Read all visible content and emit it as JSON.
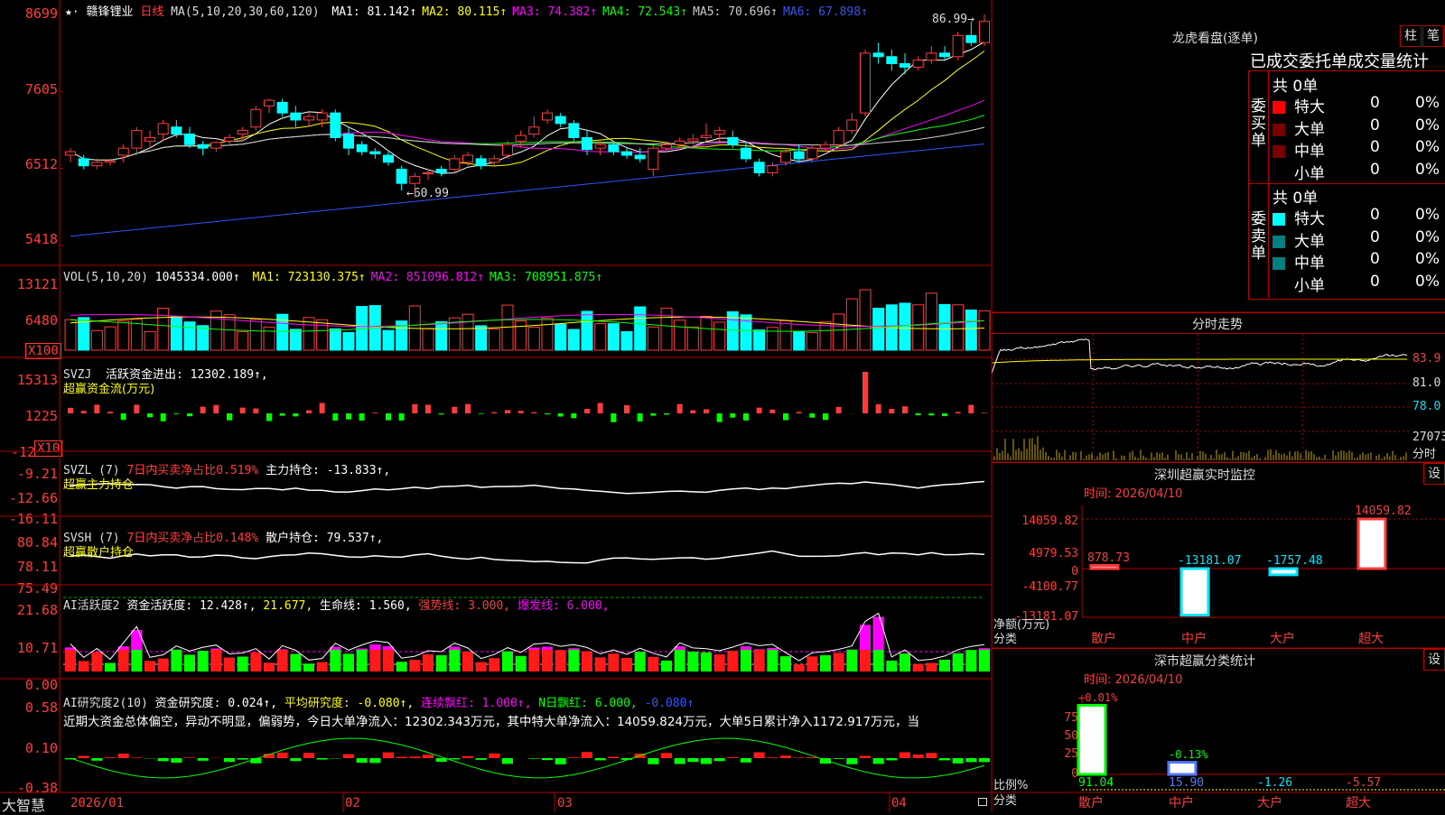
{
  "main": {
    "stock_name": "赣锋锂业",
    "period": "日线",
    "ma_params": "MA(5,10,20,30,60,120)",
    "ma_values": [
      {
        "label": "MA1: 81.142↑",
        "color": "#ffffff"
      },
      {
        "label": "MA2: 80.115↑",
        "color": "#ffff00"
      },
      {
        "label": "MA3: 74.382↑",
        "color": "#ff00ff"
      },
      {
        "label": "MA4: 72.543↑",
        "color": "#00ff00"
      },
      {
        "label": "MA5: 70.696↑",
        "color": "#cccccc"
      },
      {
        "label": "MA6: 67.898↑",
        "color": "#3355ff"
      }
    ],
    "y_ticks": [
      "8699",
      "7605",
      "6512",
      "5418"
    ],
    "high_mark": "86.99",
    "low_mark": "←60.99"
  },
  "vol": {
    "label": "VOL(5,10,20)",
    "value": "1045334.000↑",
    "ma": [
      {
        "label": "MA1: 723130.375↑",
        "color": "#ffff00"
      },
      {
        "label": "MA2: 851096.812↑",
        "color": "#ff00ff"
      },
      {
        "label": "MA3: 708951.875↑",
        "color": "#00ff00"
      }
    ],
    "y_ticks": [
      "13121",
      "6480"
    ],
    "unit": "X100"
  },
  "svzj": {
    "label": "SVZJ",
    "text": "活跃资金进出: 12302.189↑,",
    "subtitle": "超赢资金流(万元)",
    "y_ticks": [
      "15313",
      "1225",
      "-12"
    ],
    "unit": "X10"
  },
  "svzl": {
    "label": "SVZL (7)",
    "text1": "7日内买卖净占比0.519%",
    "text2": "主力持仓: -13.833↑,",
    "subtitle": "超赢主力持仓",
    "y_ticks": [
      "-9.21",
      "-12.66",
      "-16.11"
    ]
  },
  "svsh": {
    "label": "SVSH (7)",
    "text1": "7日内买卖净占比0.148%",
    "text2": "散户持仓: 79.537↑,",
    "subtitle": "超赢散户持仓",
    "y_ticks": [
      "80.84",
      "78.11",
      "75.49"
    ]
  },
  "ai1": {
    "label": "AI活跃度2",
    "t1": "资金活跃度: 12.428↑,",
    "t2": "21.677,",
    "t3": "生命线: 1.560,",
    "t4": "强势线: 3.000,",
    "t5": "爆发线: 6.000,",
    "y_ticks": [
      "21.68",
      "10.71",
      "0.00"
    ]
  },
  "ai2": {
    "label": "AI研究度2(10)",
    "t1": "资金研究度: 0.024↑,",
    "t2": "平均研究度: -0.080↑,",
    "t3": "连续飘红: 1.000↑,",
    "t4": "N日飘红: 6.000,",
    "t5": "-0.080↑",
    "comment": "近期大资金总体偏空，异动不明显，偏弱势，今日大单净流入：12302.343万元，其中特大单净流入：14059.824万元，大单5日累计净入1172.917万元，当",
    "y_ticks": [
      "0.58",
      "0.10",
      "-0.38"
    ]
  },
  "xaxis": {
    "brand": "大智慧",
    "dates": [
      "2026/01",
      "02",
      "03",
      "04"
    ]
  },
  "right": {
    "lhb_title": "龙虎看盘(逐单)",
    "btn1": "柱",
    "btn2": "笔",
    "tabs_title": "已成交委托单成交量统计",
    "buy_side": "委买单",
    "sell_side": "委卖单",
    "buy_total": "共 0单",
    "sell_total": "共 0单",
    "rows": [
      {
        "name": "特大",
        "val": "0",
        "pct": "0%"
      },
      {
        "name": "大单",
        "val": "0",
        "pct": "0%"
      },
      {
        "name": "中单",
        "val": "0",
        "pct": "0%"
      },
      {
        "name": "小单",
        "val": "0",
        "pct": "0%"
      }
    ],
    "intraday_title": "分时走势",
    "intraday_ticks": [
      "83.9",
      "81.0",
      "78.0",
      "27073",
      "分时"
    ],
    "monitor_title": "深圳超赢实时监控",
    "monitor_btn": "设",
    "monitor_time": "时间: 2026/04/10",
    "monitor_yticks": [
      "14059.82",
      "4979.53",
      "0",
      "-4100.77",
      "-13181.07"
    ],
    "monitor_ylabel1": "净额(万元)",
    "monitor_ylabel2": "分类",
    "monitor_bars": [
      {
        "cat": "散户",
        "value": "878.73",
        "color": "#ff3b3b"
      },
      {
        "cat": "中户",
        "value": "-13181.07",
        "color": "#00e5ff"
      },
      {
        "cat": "大户",
        "value": "-1757.48",
        "color": "#00e5ff"
      },
      {
        "cat": "超大",
        "value": "14059.82",
        "color": "#ff3b3b"
      }
    ],
    "class_title": "深市超赢分类统计",
    "class_btn": "设",
    "class_time": "时间: 2026/04/10",
    "class_yticks": [
      "75",
      "50",
      "25",
      "0"
    ],
    "class_ylabel1": "比例%",
    "class_ylabel2": "分类",
    "class_bars": [
      {
        "cat": "散户",
        "top": "+0.01%",
        "bottom": "91.04",
        "bottom_color": "#00ff00"
      },
      {
        "cat": "中户",
        "top": "-0.13%",
        "bottom": "15.90",
        "bottom_color": "#5577ff"
      },
      {
        "cat": "大户",
        "top": "",
        "bottom": "-1.26",
        "bottom_color": "#00e5ff"
      },
      {
        "cat": "超大",
        "top": "",
        "bottom": "-5.57",
        "bottom_color": "#ff3b3b"
      }
    ]
  },
  "chart_data": {
    "type": "candlestick",
    "candles": [
      [
        67,
        68,
        66,
        67.5
      ],
      [
        66.5,
        67,
        65,
        65.5
      ],
      [
        65.5,
        66.5,
        65,
        66
      ],
      [
        66,
        66.5,
        65.5,
        66.2
      ],
      [
        67,
        68.5,
        66,
        68
      ],
      [
        68,
        71,
        67,
        70.5
      ],
      [
        69,
        70.5,
        68,
        69.5
      ],
      [
        70,
        72,
        69,
        71.5
      ],
      [
        71,
        72,
        69.5,
        70
      ],
      [
        70,
        71,
        68,
        68.5
      ],
      [
        68.5,
        69,
        67,
        68
      ],
      [
        68,
        69,
        67.5,
        68.8
      ],
      [
        69,
        70,
        68.5,
        69.5
      ],
      [
        70,
        71,
        69,
        70.5
      ],
      [
        71,
        74,
        70.5,
        73.5
      ],
      [
        74,
        75,
        73,
        74.8
      ],
      [
        74.5,
        75,
        72.5,
        73
      ],
      [
        73,
        74,
        71,
        72
      ],
      [
        72,
        73,
        71,
        72.5
      ],
      [
        72,
        73.5,
        71,
        73
      ],
      [
        73,
        73.5,
        69,
        69.5
      ],
      [
        70,
        71,
        67,
        68
      ],
      [
        68.5,
        69,
        67,
        67.5
      ],
      [
        67.5,
        68,
        66.5,
        67.2
      ],
      [
        67,
        67.5,
        65.5,
        66
      ],
      [
        65,
        65.5,
        62,
        63
      ],
      [
        63,
        64.5,
        61,
        64
      ],
      [
        64.5,
        65,
        63.5,
        64.5
      ],
      [
        65,
        65.5,
        64,
        64.5
      ],
      [
        65,
        67,
        64.5,
        66.5
      ],
      [
        66,
        67.5,
        65.5,
        67
      ],
      [
        66.5,
        67,
        65,
        65.5
      ],
      [
        66,
        67,
        65.5,
        66.5
      ],
      [
        67,
        69,
        66.5,
        68.5
      ],
      [
        69,
        70.5,
        68,
        69.8
      ],
      [
        70,
        72.5,
        69.5,
        71
      ],
      [
        72,
        73.5,
        71.5,
        73
      ],
      [
        72.5,
        73,
        71,
        71.5
      ],
      [
        71.5,
        72,
        69,
        69.5
      ],
      [
        69.5,
        70.5,
        67,
        67.8
      ],
      [
        68,
        69,
        67,
        68.5
      ],
      [
        68.5,
        69,
        67,
        67.5
      ],
      [
        67.5,
        68,
        66.5,
        67
      ],
      [
        67,
        68,
        66,
        66.5
      ],
      [
        65,
        68.5,
        64,
        68
      ],
      [
        68,
        69,
        67.5,
        68.5
      ],
      [
        68.5,
        69.5,
        68,
        69
      ],
      [
        69,
        70,
        68.5,
        69.3
      ],
      [
        69.5,
        71.5,
        69,
        69.8
      ],
      [
        70,
        71,
        69,
        70.5
      ],
      [
        69.5,
        70.5,
        68,
        68.5
      ],
      [
        68,
        69,
        66,
        66.5
      ],
      [
        66,
        66.5,
        64,
        64.5
      ],
      [
        64.5,
        66,
        64,
        65.5
      ],
      [
        66,
        68,
        65.5,
        67.5
      ],
      [
        67.5,
        68.5,
        66,
        66.5
      ],
      [
        66.5,
        68.5,
        66,
        68
      ],
      [
        68,
        69,
        67.5,
        68.5
      ],
      [
        68.5,
        71,
        68,
        70.5
      ],
      [
        70.5,
        73,
        70,
        72
      ],
      [
        73,
        82,
        72.5,
        81.5
      ],
      [
        81.5,
        83,
        80,
        81
      ],
      [
        81,
        82,
        79,
        80
      ],
      [
        80,
        81.5,
        78.5,
        79.5
      ],
      [
        79.5,
        81,
        79,
        80.5
      ],
      [
        80.5,
        82.5,
        80,
        81.5
      ],
      [
        81.5,
        82.5,
        80.5,
        81
      ],
      [
        81,
        84.5,
        80.5,
        84
      ],
      [
        84,
        86,
        82.5,
        83
      ],
      [
        83,
        86.99,
        82.5,
        86
      ]
    ]
  }
}
